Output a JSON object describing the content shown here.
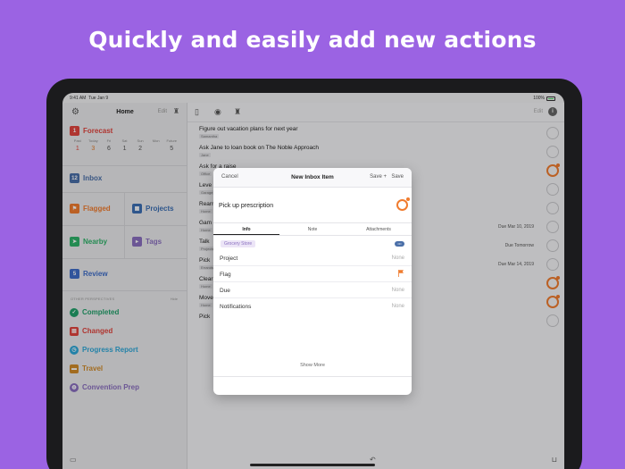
{
  "headline": "Quickly and easily add new actions",
  "colors": {
    "background": "#9b63e3",
    "forecast": "#e0443e",
    "inbox": "#4a6fa8",
    "flagged": "#f07c2f",
    "projects": "#3c6fb4",
    "nearby": "#2fb36a",
    "tags": "#8a6fbf",
    "review": "#3f6ec8"
  },
  "status_bar": {
    "time": "9:41 AM",
    "date": "Tue Jan 9",
    "battery": "100%"
  },
  "sidebar": {
    "title": "Home",
    "edit": "Edit",
    "forecast": {
      "label": "Forecast",
      "badge": "1",
      "days": [
        "Past",
        "Today",
        "Fri",
        "Sat",
        "Sun",
        "Mon",
        "Future"
      ],
      "counts": [
        "1",
        "3",
        "6",
        "1",
        "2",
        "",
        "5"
      ]
    },
    "inbox": {
      "label": "Inbox",
      "badge": "12"
    },
    "tiles": [
      {
        "label": "Flagged",
        "icon": "flag-icon"
      },
      {
        "label": "Projects",
        "icon": "projects-icon"
      },
      {
        "label": "Nearby",
        "icon": "location-icon"
      },
      {
        "label": "Tags",
        "icon": "tag-icon"
      }
    ],
    "review": {
      "label": "Review",
      "badge": "5"
    },
    "other_header": "OTHER PERSPECTIVES",
    "hide": "Hide",
    "other": [
      {
        "label": "Completed",
        "color": "#22a06b",
        "icon": "check-icon"
      },
      {
        "label": "Changed",
        "color": "#e0443e",
        "icon": "calendar-icon"
      },
      {
        "label": "Progress Report",
        "color": "#2ea7d8",
        "icon": "clock-icon"
      },
      {
        "label": "Travel",
        "color": "#d08b2a",
        "icon": "suitcase-icon"
      },
      {
        "label": "Convention Prep",
        "color": "#8a6fbf",
        "icon": "globe-icon"
      }
    ]
  },
  "main": {
    "edit": "Edit",
    "rows": [
      {
        "title": "Figure out vacation plans for next year",
        "tag": "Samantha",
        "due": "",
        "flagged": false
      },
      {
        "title": "Ask Jane to loan book on The Noble Approach",
        "tag": "Jane",
        "due": "",
        "flagged": false
      },
      {
        "title": "Ask for a raise",
        "tag": "Office",
        "due": "",
        "flagged": true
      },
      {
        "title": "Leve",
        "tag": "Garage",
        "due": "",
        "flagged": false
      },
      {
        "title": "Rearr",
        "tag": "Home",
        "due": "",
        "flagged": false
      },
      {
        "title": "Gam",
        "tag": "Home",
        "due": "Due Mar 10, 2019",
        "flagged": false
      },
      {
        "title": "Talk",
        "tag": "Projects",
        "due": "Due Tomorrow",
        "flagged": false
      },
      {
        "title": "Pick",
        "tag": "Errands",
        "due": "Due Mar 14, 2019",
        "flagged": false
      },
      {
        "title": "Clear",
        "tag": "Home",
        "due": "",
        "flagged": true
      },
      {
        "title": "Move",
        "tag": "Home",
        "due": "",
        "flagged": true
      },
      {
        "title": "Pick",
        "tag": "",
        "due": "",
        "flagged": false
      }
    ]
  },
  "modal": {
    "cancel": "Cancel",
    "title": "New Inbox Item",
    "save_plus": "Save +",
    "save": "Save",
    "task_name": "Pick up prescription",
    "tabs": [
      "Info",
      "Note",
      "Attachments"
    ],
    "tag_chip": "Grocery Store",
    "fields": [
      {
        "key": "Project",
        "value": "None"
      },
      {
        "key": "Flag",
        "value": ""
      },
      {
        "key": "Due",
        "value": "None"
      },
      {
        "key": "Notifications",
        "value": "None"
      }
    ],
    "show_more": "Show More"
  }
}
